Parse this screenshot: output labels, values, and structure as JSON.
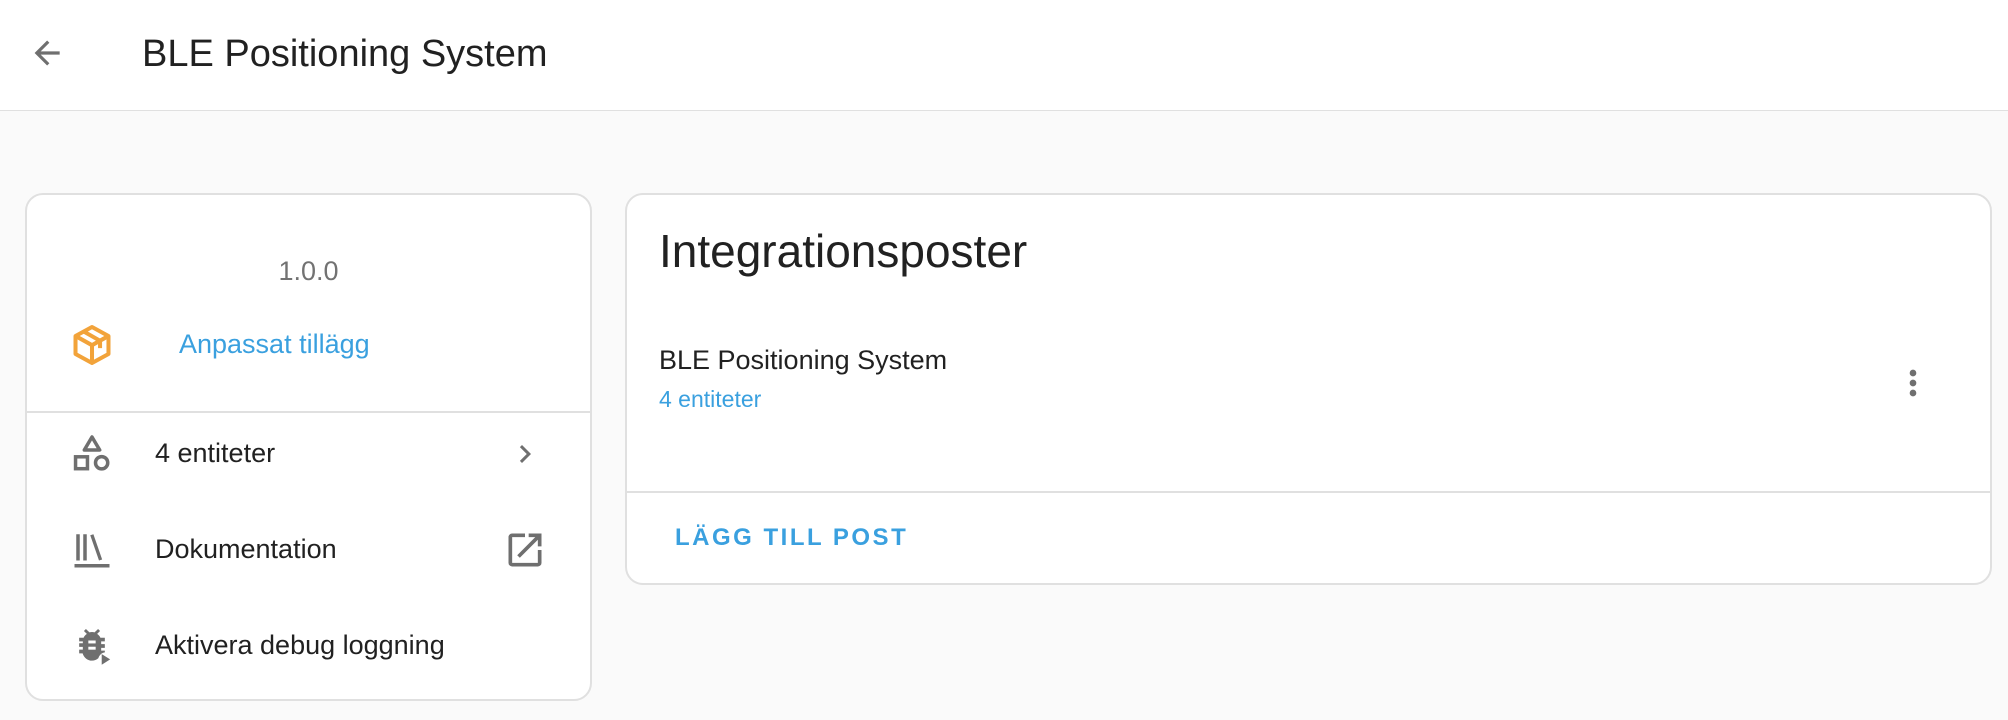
{
  "header": {
    "title": "BLE Positioning System",
    "back_icon": "arrow-left-icon"
  },
  "info_card": {
    "version": "1.0.0",
    "custom_integration": {
      "label": "Anpassat tillägg",
      "icon": "package-variant-icon",
      "icon_color": "#f2a33a"
    },
    "menu": [
      {
        "label": "4 entiteter",
        "icon": "shape-outline-icon",
        "trailing_icon": "chevron-right-icon"
      },
      {
        "label": "Dokumentation",
        "icon": "bookshelf-icon",
        "trailing_icon": "open-in-new-icon"
      },
      {
        "label": "Aktivera debug loggning",
        "icon": "bug-play-icon"
      }
    ]
  },
  "entries_card": {
    "title": "Integrationsposter",
    "entries": [
      {
        "name": "BLE Positioning System",
        "sub": "4 entiteter",
        "menu_icon": "dots-vertical-icon"
      }
    ],
    "add_button": "LÄGG TILL POST"
  },
  "colors": {
    "accent": "#3aa0df",
    "text_primary": "#212121",
    "text_secondary": "#727272",
    "icon": "#6f6f6f",
    "divider": "#e0e0e0",
    "background": "#fafafa",
    "custom_badge": "#f2a33a"
  }
}
